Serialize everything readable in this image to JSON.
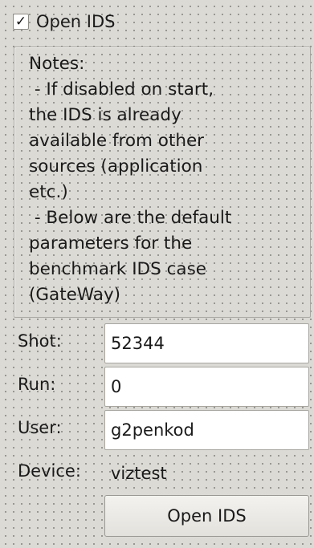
{
  "open_ids_checkbox": {
    "checked": true,
    "check_glyph": "✓",
    "label": "Open IDS"
  },
  "notes": {
    "text": "Notes:\n - If disabled on start,\nthe IDS is already\navailable from other\nsources (application\netc.)\n - Below are the default\nparameters for the\nbenchmark IDS case\n(GateWay)"
  },
  "form": {
    "shot": {
      "label": "Shot:",
      "value": "52344"
    },
    "run": {
      "label": "Run:",
      "value": "0"
    },
    "user": {
      "label": "User:",
      "value": "g2penkod"
    },
    "device": {
      "label": "Device:",
      "value": "viztest"
    }
  },
  "open_button": {
    "label": "Open IDS"
  }
}
